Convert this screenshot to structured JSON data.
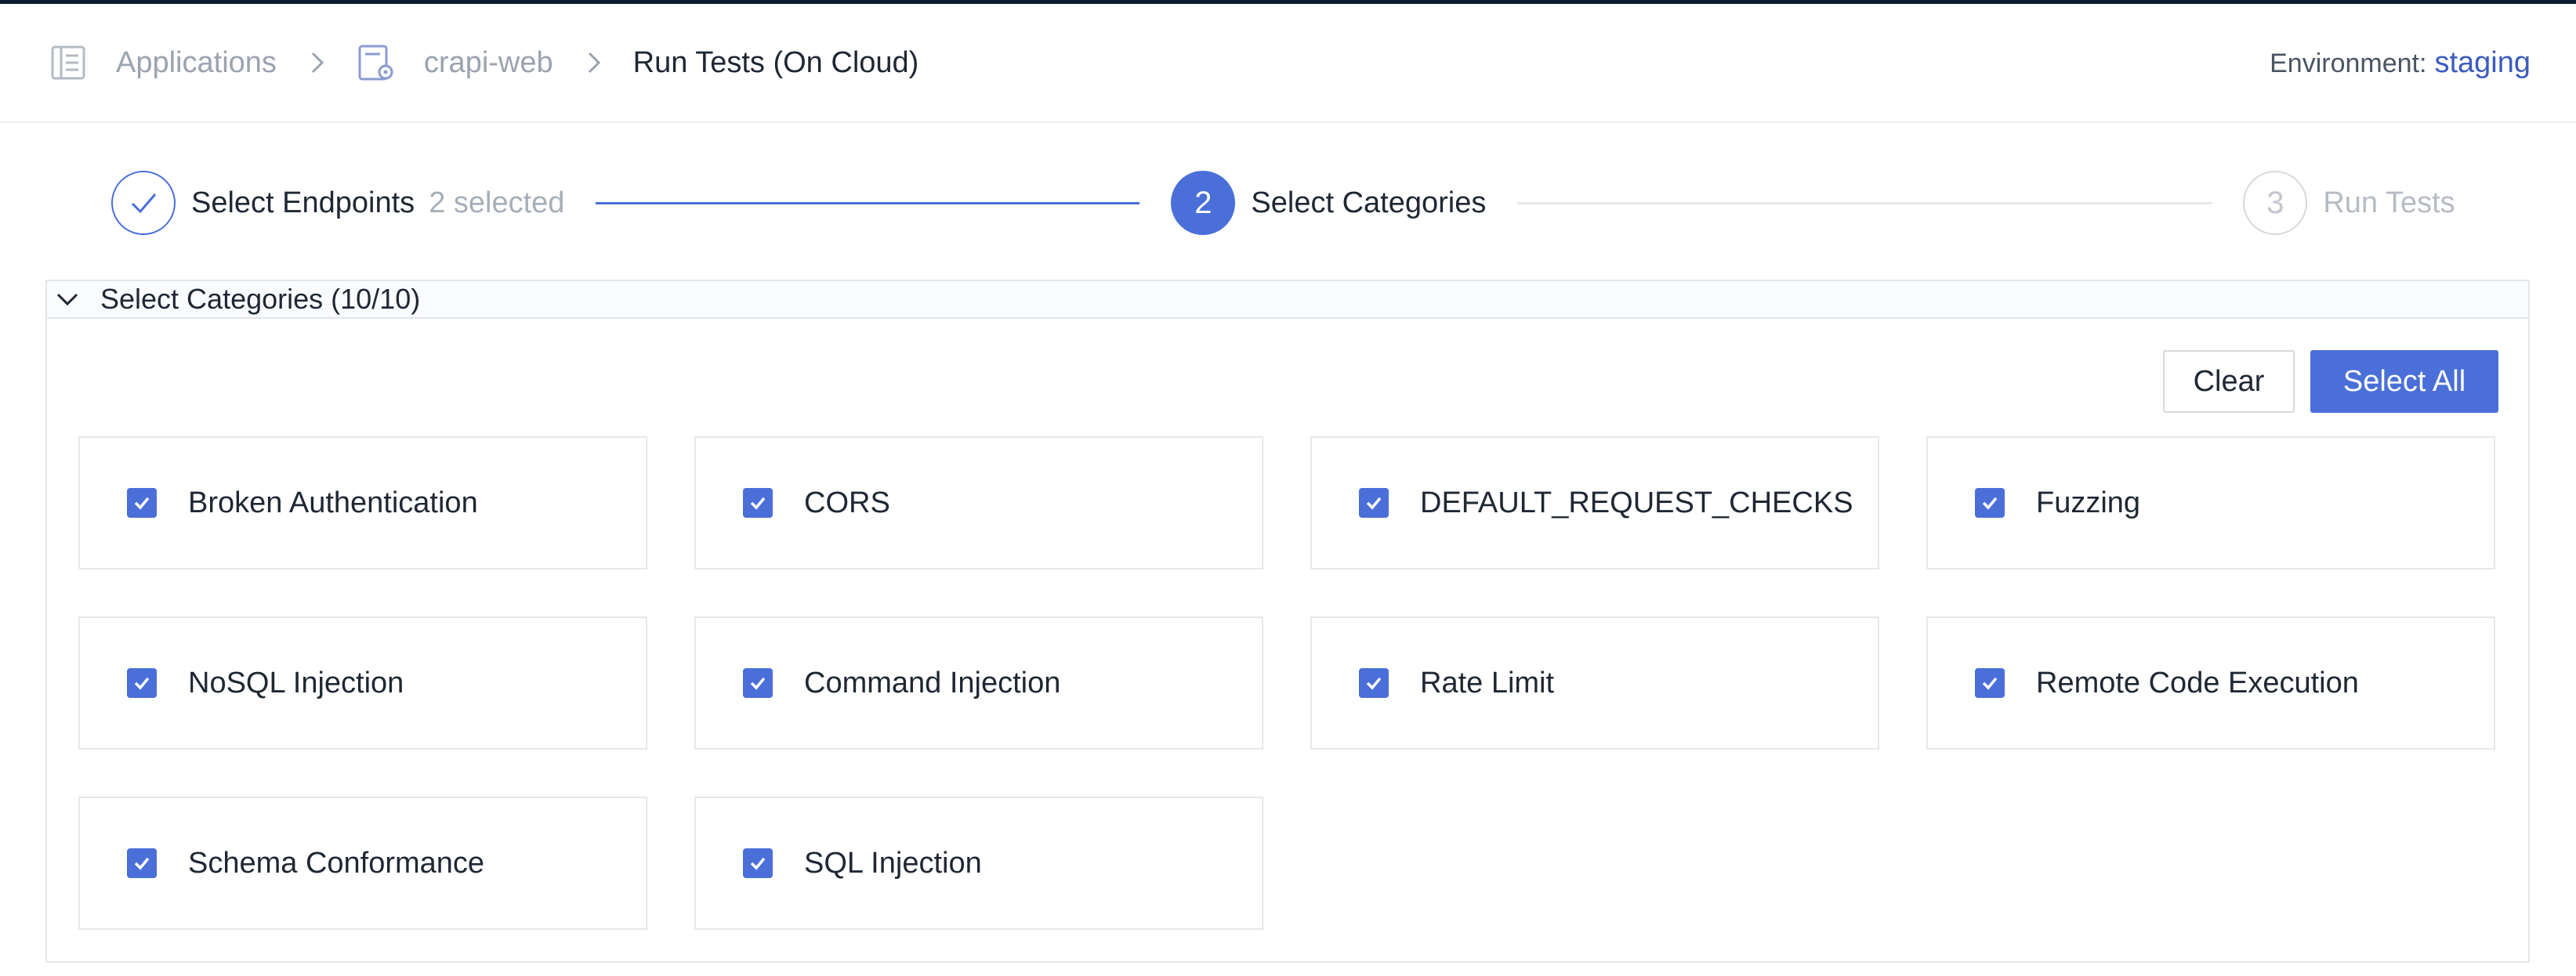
{
  "header": {
    "breadcrumbs": [
      {
        "label": "Applications",
        "icon": "applications-icon"
      },
      {
        "label": "crapi-web",
        "icon": "app-settings-icon"
      },
      {
        "label": "Run Tests (On Cloud)"
      }
    ],
    "environment_label": "Environment:",
    "environment_value": "staging"
  },
  "steps": [
    {
      "number": "",
      "title": "Select Endpoints",
      "subtitle": "2 selected",
      "state": "done"
    },
    {
      "number": "2",
      "title": "Select Categories",
      "state": "active"
    },
    {
      "number": "3",
      "title": "Run Tests",
      "state": "pending"
    }
  ],
  "panel": {
    "title": "Select Categories (10/10)",
    "clear_label": "Clear",
    "select_all_label": "Select All"
  },
  "categories": [
    {
      "label": "Broken Authentication",
      "checked": true
    },
    {
      "label": "CORS",
      "checked": true
    },
    {
      "label": "DEFAULT_REQUEST_CHECKS",
      "checked": true
    },
    {
      "label": "Fuzzing",
      "checked": true
    },
    {
      "label": "NoSQL Injection",
      "checked": true
    },
    {
      "label": "Command Injection",
      "checked": true
    },
    {
      "label": "Rate Limit",
      "checked": true
    },
    {
      "label": "Remote Code Execution",
      "checked": true
    },
    {
      "label": "Schema Conformance",
      "checked": true
    },
    {
      "label": "SQL Injection",
      "checked": true
    }
  ],
  "colors": {
    "accent": "#4a6fd9",
    "link": "#3c5bbf",
    "top_bar": "#0d1b33"
  }
}
